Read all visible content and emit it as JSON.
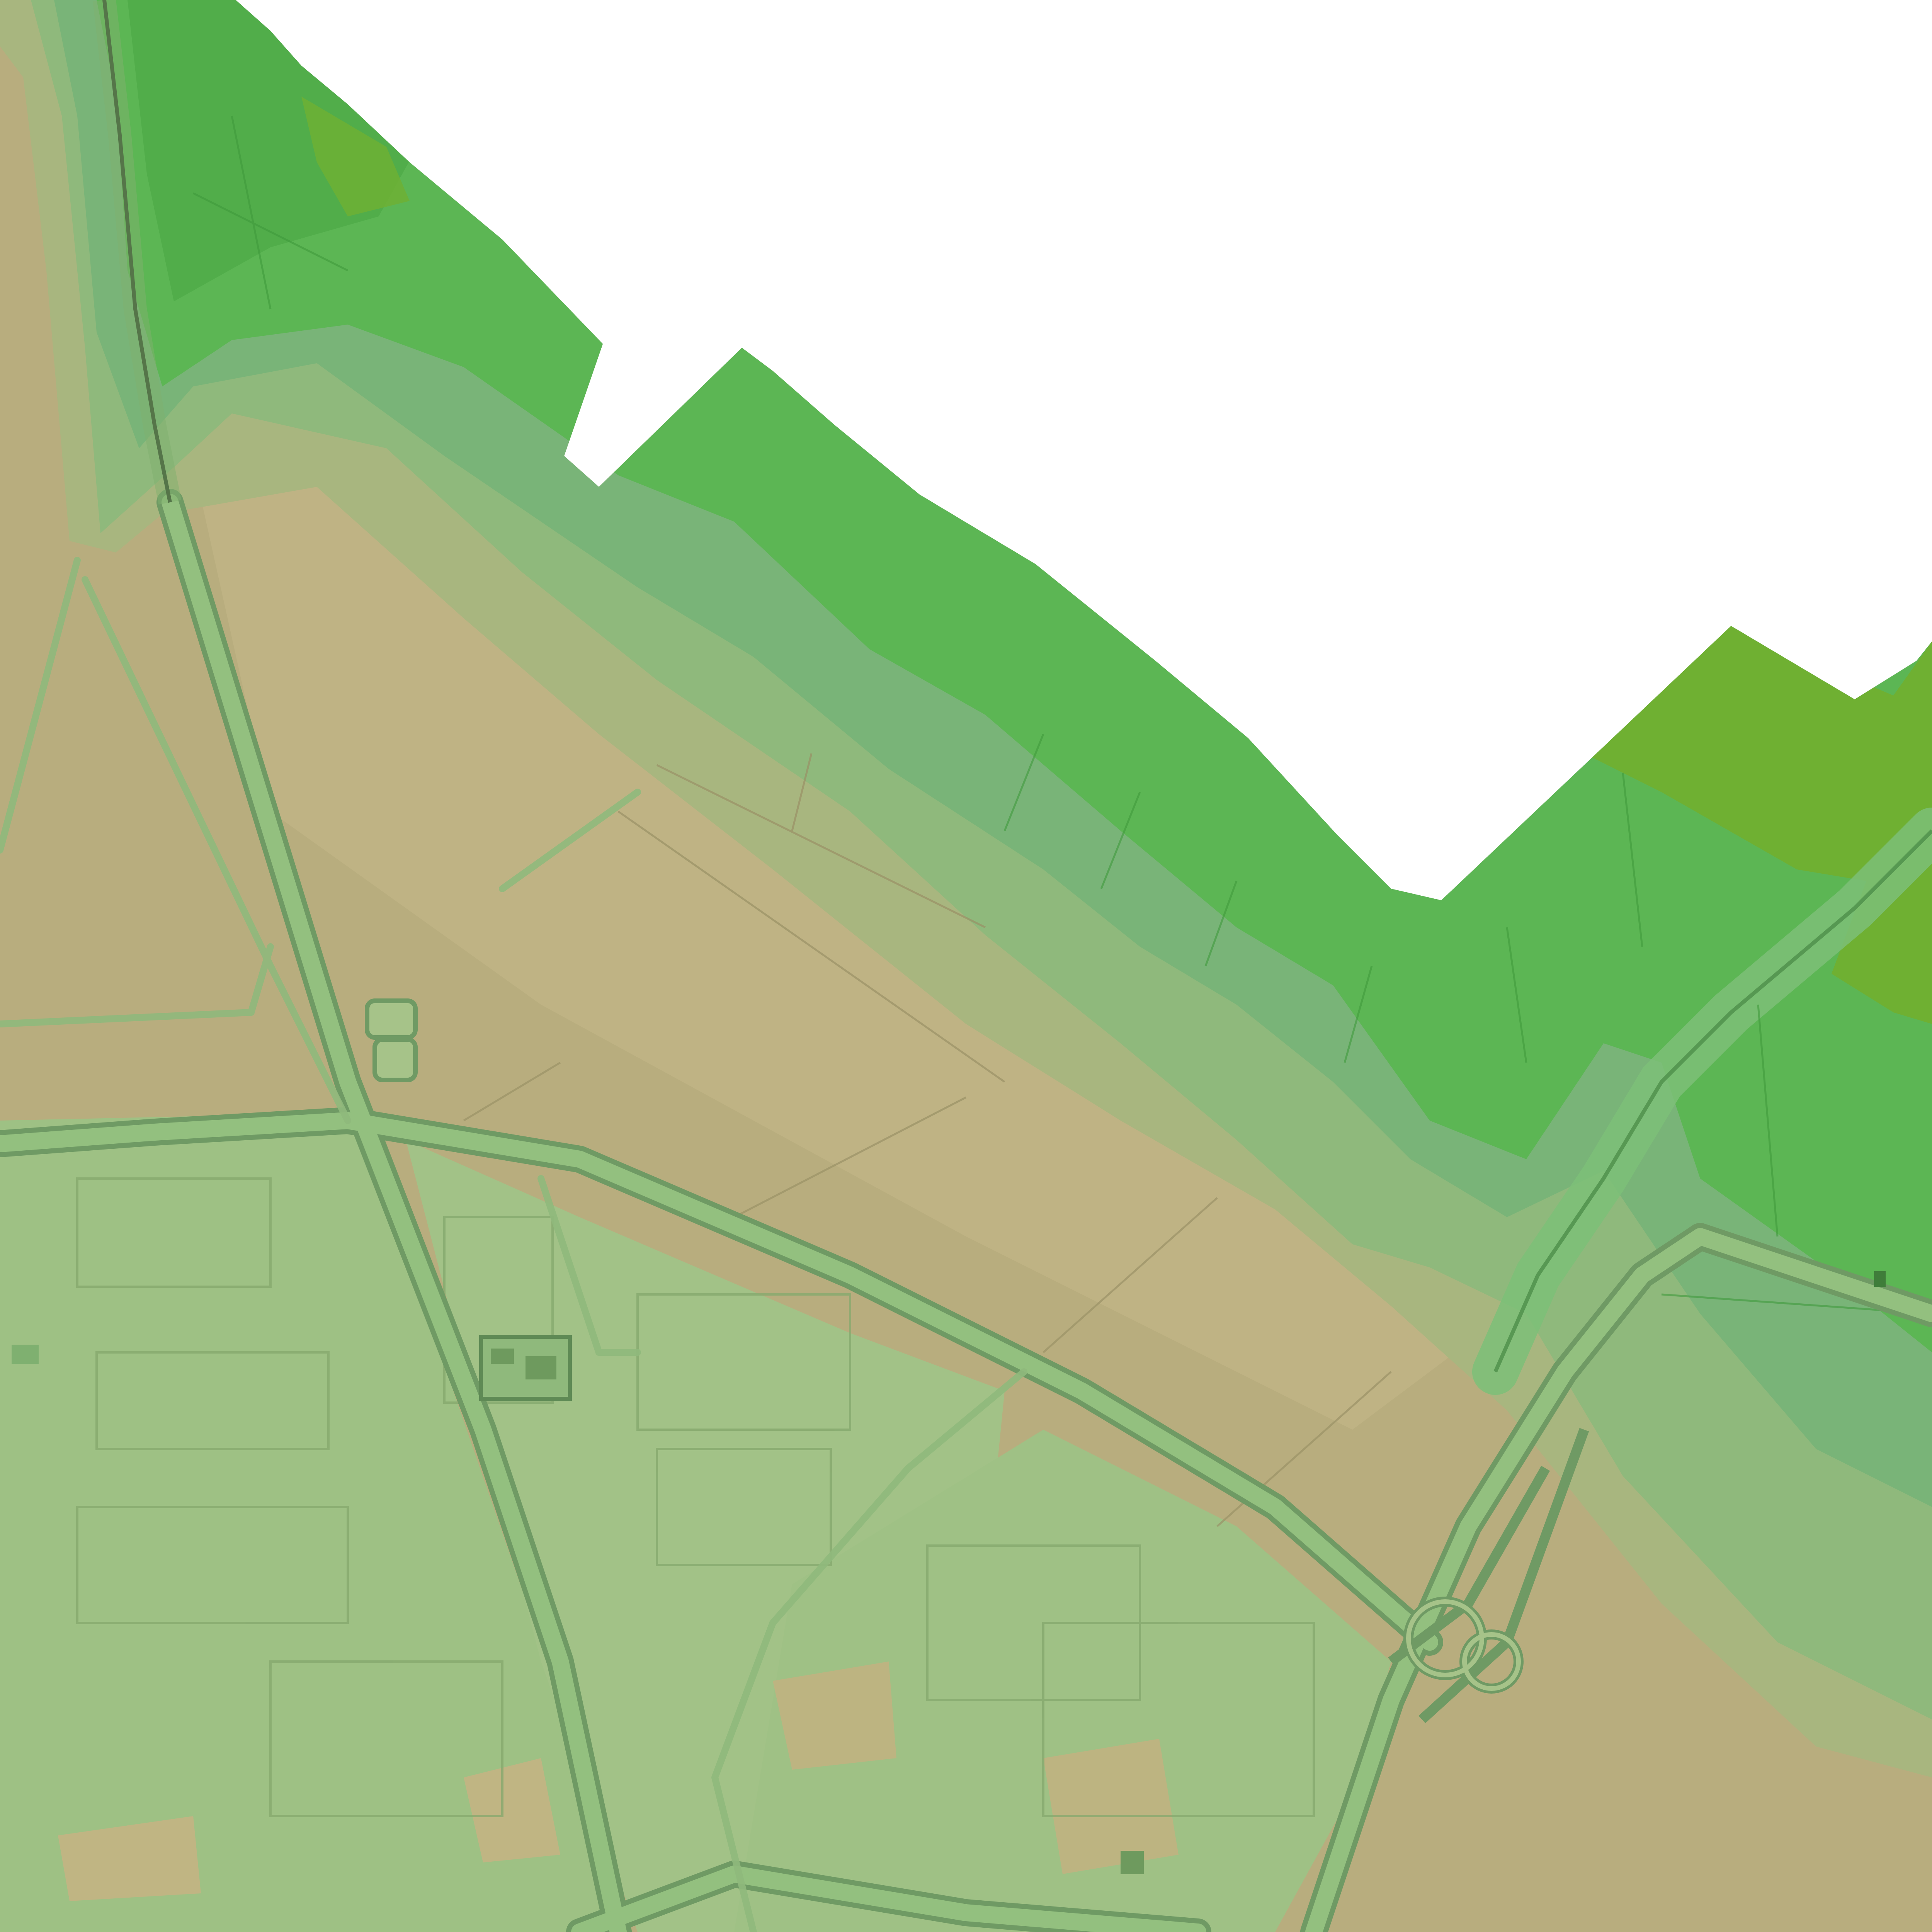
{
  "map": {
    "kind": "shaded-relief elevation raster",
    "hillshade": true,
    "labels_printed": false,
    "colors": {
      "nodata": "#ffffff",
      "lowland": "#b8ad7e",
      "lowland_light": "#c4b888",
      "lower_slope": "#a8b67f",
      "mid_slope": "#8fb97c",
      "upper_slope": "#79b478",
      "upland": "#5cb654",
      "upland_dark": "#4aa745",
      "crest": "#6fb032",
      "urban_fill": "#9ec184",
      "road": "#93c07f",
      "road_edge": "#6f9a64",
      "rail": "#2a3a25"
    },
    "features": [
      "upland-plateau",
      "escarpment-bands",
      "lowland-plain",
      "urban-industrial-area",
      "motorway-interchange",
      "railway-line",
      "river-valley",
      "settling-ponds"
    ]
  }
}
